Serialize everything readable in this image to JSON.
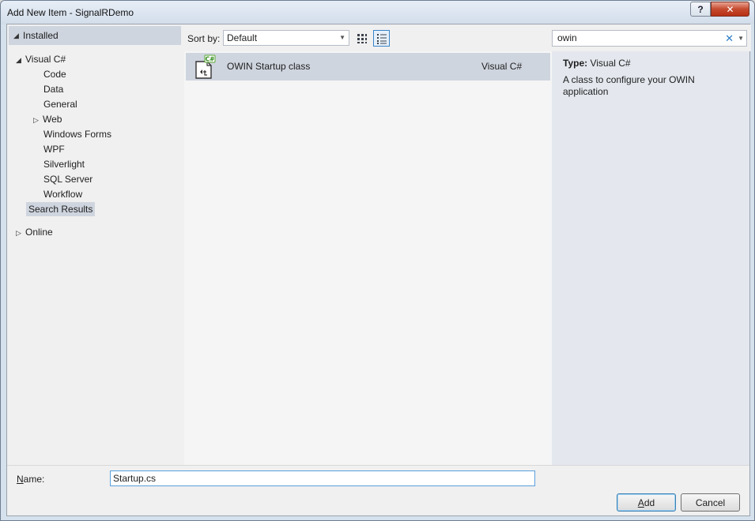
{
  "window": {
    "title": "Add New Item - SignalRDemo",
    "help_label": "?",
    "close_label": "✕"
  },
  "tree": {
    "installed_label": "Installed",
    "visual_csharp_label": "Visual C#",
    "children": [
      "Code",
      "Data",
      "General",
      "Web",
      "Windows Forms",
      "WPF",
      "Silverlight",
      "SQL Server",
      "Workflow"
    ],
    "search_results_label": "Search Results",
    "online_label": "Online"
  },
  "toolbar": {
    "sort_by_label": "Sort by:",
    "sort_value": "Default",
    "search_value": "owin"
  },
  "templates": [
    {
      "name": "OWIN Startup class",
      "language": "Visual C#",
      "badge": "C#"
    }
  ],
  "details": {
    "type_label": "Type:",
    "type_value": "Visual C#",
    "description": "A class to configure your OWIN application"
  },
  "footer": {
    "name_label_prefix": "N",
    "name_label_rest": "ame:",
    "name_value": "Startup.cs",
    "add_label_prefix": "A",
    "add_label_rest": "dd",
    "cancel_label": "Cancel"
  },
  "icons": {
    "help": "help-icon",
    "close": "close-icon",
    "expanded": "triangle-down-icon",
    "collapsed": "triangle-right-icon",
    "grid_view": "grid-view-icon",
    "list_view": "list-view-icon",
    "clear_search": "clear-icon",
    "dropdown": "chevron-down-icon",
    "template": "csharp-class-icon"
  },
  "colors": {
    "selection": "#cfd5df",
    "accent": "#3a84c9",
    "close_button": "#c54a2f"
  }
}
